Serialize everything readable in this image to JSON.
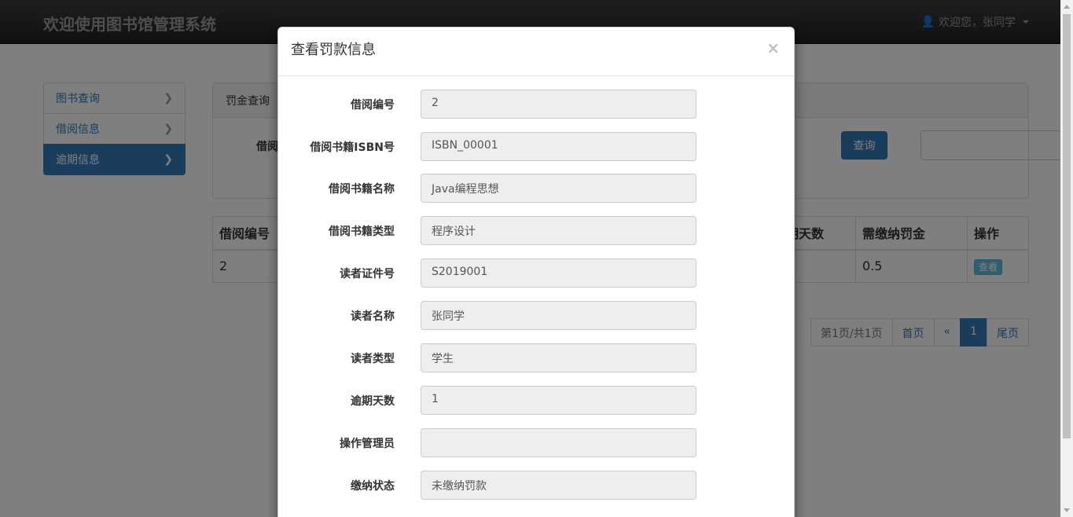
{
  "navbar": {
    "brand": "欢迎使用图书馆管理系统",
    "user_label": "欢迎您，张同学"
  },
  "sidebar": {
    "items": [
      {
        "label": "图书查询"
      },
      {
        "label": "借阅信息"
      },
      {
        "label": "逾期信息"
      }
    ]
  },
  "panel": {
    "heading": "罚金查询",
    "field_label": "借阅",
    "query_button": "查询"
  },
  "table": {
    "headers": [
      "借阅编号",
      "期天数",
      "需缴纳罚金",
      "操作"
    ],
    "row": {
      "id": "2",
      "fine": "0.5",
      "action": "查看"
    }
  },
  "pagination": {
    "info": "第1页/共1页",
    "first": "首页",
    "prev": "«",
    "current": "1",
    "last": "尾页"
  },
  "modal": {
    "title": "查看罚款信息",
    "close": "×",
    "fields": [
      {
        "label": "借阅编号",
        "value": "2"
      },
      {
        "label": "借阅书籍ISBN号",
        "value": "ISBN_00001"
      },
      {
        "label": "借阅书籍名称",
        "value": "Java编程思想"
      },
      {
        "label": "借阅书籍类型",
        "value": "程序设计"
      },
      {
        "label": "读者证件号",
        "value": "S2019001"
      },
      {
        "label": "读者名称",
        "value": "张同学"
      },
      {
        "label": "读者类型",
        "value": "学生"
      },
      {
        "label": "逾期天数",
        "value": "1"
      },
      {
        "label": "操作管理员",
        "value": ""
      },
      {
        "label": "缴纳状态",
        "value": "未缴纳罚款"
      }
    ]
  }
}
